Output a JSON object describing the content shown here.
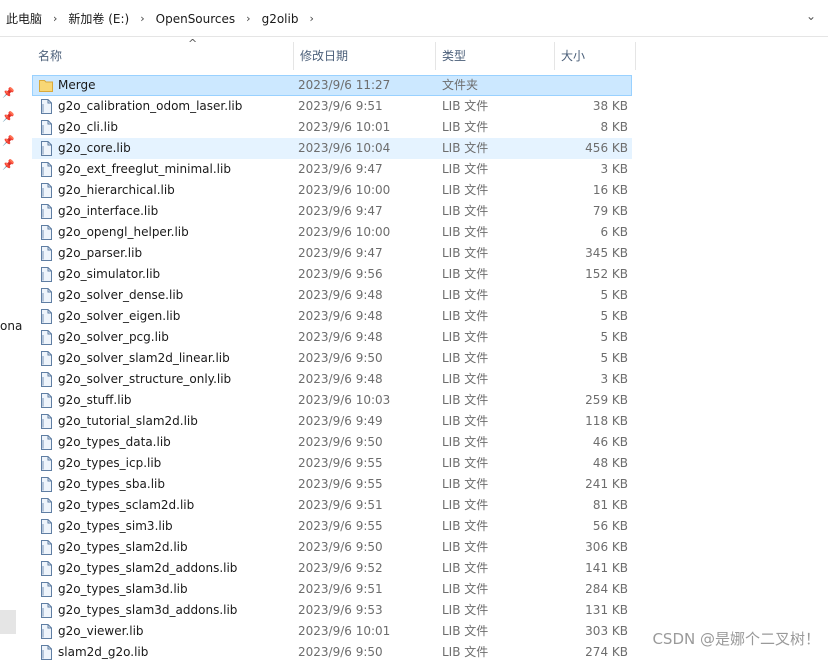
{
  "breadcrumb": [
    "此电脑",
    "新加卷 (E:)",
    "OpenSources",
    "g2olib"
  ],
  "left_nav": {
    "partial_label": "ona"
  },
  "columns": {
    "name": "名称",
    "date": "修改日期",
    "type": "类型",
    "size": "大小"
  },
  "files": [
    {
      "name": "Merge",
      "date": "2023/9/6 11:27",
      "type": "文件夹",
      "size": "",
      "icon": "folder-icon"
    },
    {
      "name": "g2o_calibration_odom_laser.lib",
      "date": "2023/9/6 9:51",
      "type": "LIB 文件",
      "size": "38 KB",
      "icon": "lib-file-icon"
    },
    {
      "name": "g2o_cli.lib",
      "date": "2023/9/6 10:01",
      "type": "LIB 文件",
      "size": "8 KB",
      "icon": "lib-file-icon"
    },
    {
      "name": "g2o_core.lib",
      "date": "2023/9/6 10:04",
      "type": "LIB 文件",
      "size": "456 KB",
      "icon": "lib-file-icon"
    },
    {
      "name": "g2o_ext_freeglut_minimal.lib",
      "date": "2023/9/6 9:47",
      "type": "LIB 文件",
      "size": "3 KB",
      "icon": "lib-file-icon"
    },
    {
      "name": "g2o_hierarchical.lib",
      "date": "2023/9/6 10:00",
      "type": "LIB 文件",
      "size": "16 KB",
      "icon": "lib-file-icon"
    },
    {
      "name": "g2o_interface.lib",
      "date": "2023/9/6 9:47",
      "type": "LIB 文件",
      "size": "79 KB",
      "icon": "lib-file-icon"
    },
    {
      "name": "g2o_opengl_helper.lib",
      "date": "2023/9/6 10:00",
      "type": "LIB 文件",
      "size": "6 KB",
      "icon": "lib-file-icon"
    },
    {
      "name": "g2o_parser.lib",
      "date": "2023/9/6 9:47",
      "type": "LIB 文件",
      "size": "345 KB",
      "icon": "lib-file-icon"
    },
    {
      "name": "g2o_simulator.lib",
      "date": "2023/9/6 9:56",
      "type": "LIB 文件",
      "size": "152 KB",
      "icon": "lib-file-icon"
    },
    {
      "name": "g2o_solver_dense.lib",
      "date": "2023/9/6 9:48",
      "type": "LIB 文件",
      "size": "5 KB",
      "icon": "lib-file-icon"
    },
    {
      "name": "g2o_solver_eigen.lib",
      "date": "2023/9/6 9:48",
      "type": "LIB 文件",
      "size": "5 KB",
      "icon": "lib-file-icon"
    },
    {
      "name": "g2o_solver_pcg.lib",
      "date": "2023/9/6 9:48",
      "type": "LIB 文件",
      "size": "5 KB",
      "icon": "lib-file-icon"
    },
    {
      "name": "g2o_solver_slam2d_linear.lib",
      "date": "2023/9/6 9:50",
      "type": "LIB 文件",
      "size": "5 KB",
      "icon": "lib-file-icon"
    },
    {
      "name": "g2o_solver_structure_only.lib",
      "date": "2023/9/6 9:48",
      "type": "LIB 文件",
      "size": "3 KB",
      "icon": "lib-file-icon"
    },
    {
      "name": "g2o_stuff.lib",
      "date": "2023/9/6 10:03",
      "type": "LIB 文件",
      "size": "259 KB",
      "icon": "lib-file-icon"
    },
    {
      "name": "g2o_tutorial_slam2d.lib",
      "date": "2023/9/6 9:49",
      "type": "LIB 文件",
      "size": "118 KB",
      "icon": "lib-file-icon"
    },
    {
      "name": "g2o_types_data.lib",
      "date": "2023/9/6 9:50",
      "type": "LIB 文件",
      "size": "46 KB",
      "icon": "lib-file-icon"
    },
    {
      "name": "g2o_types_icp.lib",
      "date": "2023/9/6 9:55",
      "type": "LIB 文件",
      "size": "48 KB",
      "icon": "lib-file-icon"
    },
    {
      "name": "g2o_types_sba.lib",
      "date": "2023/9/6 9:55",
      "type": "LIB 文件",
      "size": "241 KB",
      "icon": "lib-file-icon"
    },
    {
      "name": "g2o_types_sclam2d.lib",
      "date": "2023/9/6 9:51",
      "type": "LIB 文件",
      "size": "81 KB",
      "icon": "lib-file-icon"
    },
    {
      "name": "g2o_types_sim3.lib",
      "date": "2023/9/6 9:55",
      "type": "LIB 文件",
      "size": "56 KB",
      "icon": "lib-file-icon"
    },
    {
      "name": "g2o_types_slam2d.lib",
      "date": "2023/9/6 9:50",
      "type": "LIB 文件",
      "size": "306 KB",
      "icon": "lib-file-icon"
    },
    {
      "name": "g2o_types_slam2d_addons.lib",
      "date": "2023/9/6 9:52",
      "type": "LIB 文件",
      "size": "141 KB",
      "icon": "lib-file-icon"
    },
    {
      "name": "g2o_types_slam3d.lib",
      "date": "2023/9/6 9:51",
      "type": "LIB 文件",
      "size": "284 KB",
      "icon": "lib-file-icon"
    },
    {
      "name": "g2o_types_slam3d_addons.lib",
      "date": "2023/9/6 9:53",
      "type": "LIB 文件",
      "size": "131 KB",
      "icon": "lib-file-icon"
    },
    {
      "name": "g2o_viewer.lib",
      "date": "2023/9/6 10:01",
      "type": "LIB 文件",
      "size": "303 KB",
      "icon": "lib-file-icon"
    },
    {
      "name": "slam2d_g2o.lib",
      "date": "2023/9/6 9:50",
      "type": "LIB 文件",
      "size": "274 KB",
      "icon": "lib-file-icon"
    }
  ],
  "selected_row": 0,
  "hover_row": 3,
  "watermark": "CSDN @是娜个二叉树！",
  "colors": {
    "selection": "#cce8ff",
    "hover": "#e5f3ff",
    "header_text": "#4c607a",
    "folder": "#f8d775"
  }
}
